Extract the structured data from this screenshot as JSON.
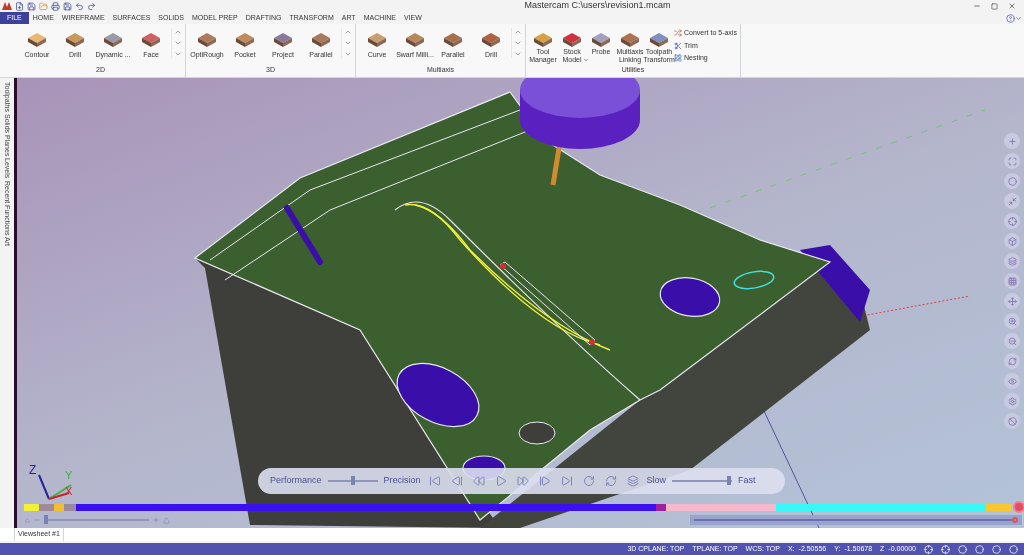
{
  "title_bar": {
    "title": "Mastercam C:\\users\\revision1.mcam"
  },
  "menu_tabs": [
    {
      "label": "FILE",
      "selected": true
    },
    {
      "label": "HOME",
      "selected": false
    },
    {
      "label": "WIREFRAME",
      "selected": false
    },
    {
      "label": "SURFACES",
      "selected": false
    },
    {
      "label": "SOLIDS",
      "selected": false
    },
    {
      "label": "MODEL PREP",
      "selected": false
    },
    {
      "label": "DRAFTING",
      "selected": false
    },
    {
      "label": "TRANSFORM",
      "selected": false
    },
    {
      "label": "ART",
      "selected": false
    },
    {
      "label": "MACHINE",
      "selected": false
    },
    {
      "label": "VIEW",
      "selected": false
    }
  ],
  "ribbon": {
    "groups": [
      {
        "label": "2D",
        "buttons": [
          {
            "label": "Contour"
          },
          {
            "label": "Drill"
          },
          {
            "label": "Dynamic ..."
          },
          {
            "label": "Face"
          }
        ]
      },
      {
        "label": "3D",
        "buttons": [
          {
            "label": "OptiRough"
          },
          {
            "label": "Pocket"
          },
          {
            "label": "Project"
          },
          {
            "label": "Parallel"
          }
        ]
      },
      {
        "label": "Multiaxis",
        "buttons": [
          {
            "label": "Curve"
          },
          {
            "label": "Swarf Milli..."
          },
          {
            "label": "Parallel"
          },
          {
            "label": "Drill"
          }
        ]
      }
    ],
    "utilities": {
      "label": "Utilities",
      "buttons": [
        {
          "label": "Tool Manager",
          "dropdown": false
        },
        {
          "label": "Stock Model",
          "dropdown": true
        },
        {
          "label": "Probe",
          "dropdown": false
        },
        {
          "label": "Multiaxis Linking",
          "dropdown": false
        },
        {
          "label": "Toolpath Transform",
          "dropdown": false
        }
      ],
      "small_buttons": [
        "Convert to 5-axis",
        "Trim",
        "Nesting"
      ]
    }
  },
  "side_tabs": [
    "Toolpaths",
    "Solids",
    "Planes",
    "Levels",
    "Recent Functions",
    "Art"
  ],
  "playback": {
    "quality_left": "Performance",
    "quality_right": "Precision",
    "quality_slider": {
      "level": 0.5
    },
    "speed_left": "Slow",
    "speed_right": "Fast",
    "speed_slider": {
      "level": 0.95
    }
  },
  "gnomon": {
    "x": "X",
    "y": "Y",
    "z": "Z"
  },
  "zoom_slider": {
    "level": 0.02
  },
  "viewsheet_tabs": [
    {
      "label": "Viewsheet #1",
      "selected": true
    }
  ],
  "status_bar": {
    "planes": [
      "3D CPLANE: TOP",
      "TPLANE: TOP",
      "WCS: TOP"
    ],
    "coords": [
      {
        "label": "X:",
        "value": "-2.50556"
      },
      {
        "label": "Y:",
        "value": "-1.50678"
      },
      {
        "label": "Z",
        "value": "-0.00000"
      }
    ]
  }
}
